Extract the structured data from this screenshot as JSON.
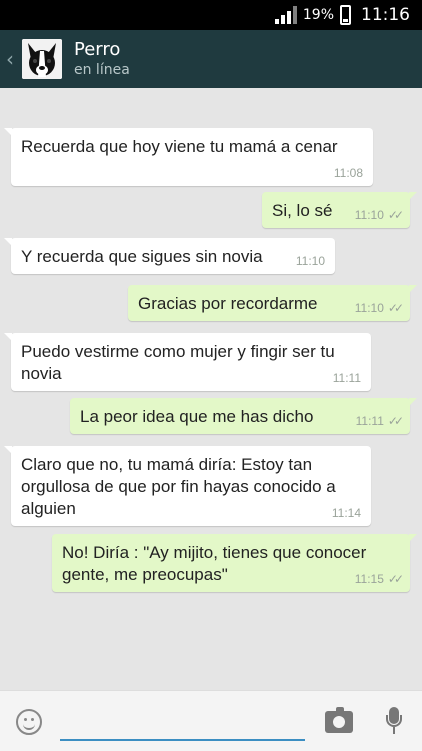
{
  "status_bar": {
    "battery_pct": "19%",
    "time": "11:16"
  },
  "header": {
    "back_icon": "chevron-left-icon",
    "contact_name": "Perro",
    "contact_status": "en línea"
  },
  "messages": [
    {
      "direction": "in",
      "text": "Recuerda que hoy viene tu mamá a cenar",
      "time": "11:08"
    },
    {
      "direction": "out",
      "text": "Si, lo sé",
      "time": "11:10",
      "read": true
    },
    {
      "direction": "in",
      "text": "Y recuerda que sigues sin novia",
      "time": "11:10"
    },
    {
      "direction": "out",
      "text": "Gracias por recordarme",
      "time": "11:10",
      "read": true
    },
    {
      "direction": "in",
      "text": "Puedo vestirme como mujer y fingir ser tu novia",
      "time": "11:11"
    },
    {
      "direction": "out",
      "text": "La peor idea que me has dicho",
      "time": "11:11",
      "read": true
    },
    {
      "direction": "in",
      "text": "Claro que no, tu mamá diría: Estoy tan orgullosa de que por fin hayas conocido a alguien",
      "time": "11:14"
    },
    {
      "direction": "out",
      "text": "No! Diría : \"Ay mijito, tienes que conocer gente, me preocupas\"",
      "time": "11:15",
      "read": true
    }
  ],
  "input_bar": {
    "emoji_icon": "smiley-icon",
    "camera_icon": "camera-icon",
    "mic_icon": "microphone-icon",
    "message_value": ""
  },
  "colors": {
    "header_bg": "#1f3a3f",
    "chat_bg": "#e5e5e5",
    "outgoing_bubble": "#e3f8c8",
    "incoming_bubble": "#ffffff",
    "input_underline": "#3b8ec2"
  }
}
